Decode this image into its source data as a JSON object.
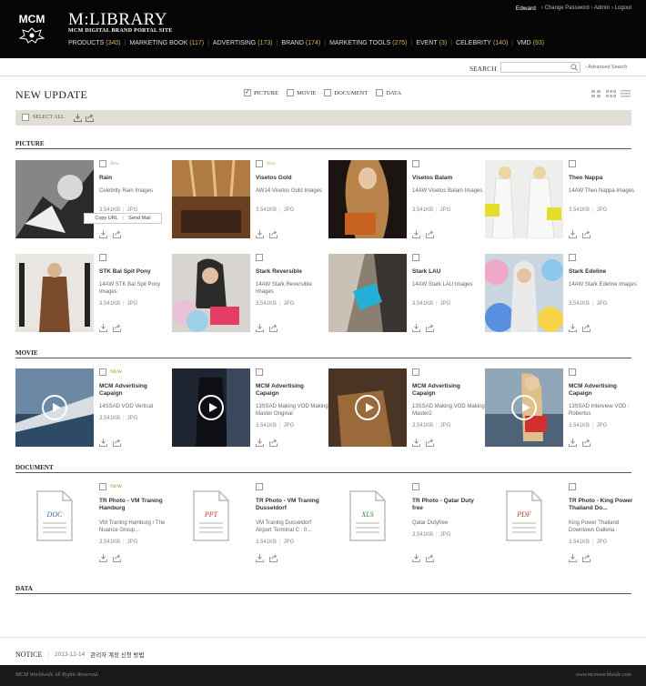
{
  "header": {
    "logo_text": "MCM",
    "title": "M:LIBRARY",
    "subtitle": "MCM DIGITAL BRAND PORTAL SITE",
    "user": "Edward",
    "links": [
      "Change Password",
      "Admin",
      "Logout"
    ],
    "nav": [
      {
        "label": "PRODUCTS",
        "count": "(340)"
      },
      {
        "label": "MARKETING BOOK",
        "count": "(117)"
      },
      {
        "label": "ADVERTISING",
        "count": "(173)"
      },
      {
        "label": "BRAND",
        "count": "(174)"
      },
      {
        "label": "MARKETING TOOLS",
        "count": "(275)"
      },
      {
        "label": "EVENT",
        "count": "(3)"
      },
      {
        "label": "CELEBRITY",
        "count": "(140)"
      },
      {
        "label": "VMD",
        "count": "(93)"
      }
    ]
  },
  "search": {
    "label": "SEARCH",
    "value": "",
    "placeholder": "",
    "advanced": "› Advanced Search"
  },
  "page": {
    "title": "NEW UPDATE"
  },
  "filters": [
    {
      "label": "PICTURE",
      "checked": true
    },
    {
      "label": "MOVIE",
      "checked": false
    },
    {
      "label": "DOCUMENT",
      "checked": false
    },
    {
      "label": "DATA",
      "checked": false
    }
  ],
  "select_all": "SELECT ALL",
  "sections": {
    "picture": "PICTURE",
    "movie": "MOVIE",
    "document": "DOCUMENT",
    "data": "DATA"
  },
  "popup": {
    "copy_url": "Copy URL",
    "send_mail": "Send Mail"
  },
  "pictures": [
    {
      "new": "New",
      "title": "Rain",
      "desc": "Celebrity Rain Images",
      "size": "3,541KB",
      "type": "JPG"
    },
    {
      "new": "New",
      "title": "Visetos Gold",
      "desc": "AW14 Visetos Gold Images",
      "size": "3,541KB",
      "type": "JPG"
    },
    {
      "new": "",
      "title": "Visetos Balam",
      "desc": "14AW Visetos Balam Images",
      "size": "3,541KB",
      "type": "JPG"
    },
    {
      "new": "",
      "title": "Theo Nappa",
      "desc": "14AW Theo Nappa Images",
      "size": "3,541KB",
      "type": "JPG"
    },
    {
      "new": "",
      "title": "STK Bal Spit Pony",
      "desc": "14AW STK Bal Spit Pony Images",
      "size": "3,541KB",
      "type": "JPG"
    },
    {
      "new": "",
      "title": "Stark Reversible",
      "desc": "14AW Stark Reversible Images",
      "size": "3,541KB",
      "type": "JPG"
    },
    {
      "new": "",
      "title": "Stark LAU",
      "desc": "14AW Stark LAU Images",
      "size": "3,541KB",
      "type": "JPG"
    },
    {
      "new": "",
      "title": "Stark Edeline",
      "desc": "14AW Stark Edeline Images",
      "size": "3,541KB",
      "type": "JPG"
    }
  ],
  "movies": [
    {
      "new": "NEW",
      "title": "MCM Advertising Capaign",
      "desc": "14SSAD VOD Vertical",
      "size": "3,541KB",
      "type": "JPG"
    },
    {
      "new": "",
      "title": "MCM Advertising Capaign",
      "desc": "13SSAD Making VOD Making Master Original",
      "size": "3,541KB",
      "type": "JPG"
    },
    {
      "new": "",
      "title": "MCM Advertising Capaign",
      "desc": "13SSAD Making VOD Making Master2",
      "size": "3,541KB",
      "type": "JPG"
    },
    {
      "new": "",
      "title": "MCM Advertising Capaign",
      "desc": "13SSAD Interview VOD : Robertus",
      "size": "3,541KB",
      "type": "JPG"
    }
  ],
  "documents": [
    {
      "new": "NEW",
      "doctype": "DOC",
      "color": "#3a63b0",
      "title": "TR Photo - VM Traning Hamburg",
      "desc": "VM Traning Hamburg / The Nuance Group...",
      "size": "3,541KB",
      "type": "JPG"
    },
    {
      "new": "",
      "doctype": "PPT",
      "color": "#c0392b",
      "title": "TR Photo - VM Traning Dusseldorf",
      "desc": "VM Traning Dusseldorf Airport Terminal C : 0...",
      "size": "3,541KB",
      "type": "JPG"
    },
    {
      "new": "",
      "doctype": "XLS",
      "color": "#2e8b3c",
      "title": "TR Photo - Qatar Duty free",
      "desc": "Qatar Dutyfree",
      "size": "3,541KB",
      "type": "JPG"
    },
    {
      "new": "",
      "doctype": "PDF",
      "color": "#c0392b",
      "title": "TR Photo - King Power Thailand Do...",
      "desc": "King Power Thailand Downtown Galleria :",
      "size": "3,541KB",
      "type": "JPG"
    }
  ],
  "notice": {
    "label": "NOTICE",
    "date": "2013-12-14",
    "text": "관리자 계정 신청 방법"
  },
  "footer": {
    "copyright": "MCM Worldwide All Rights Reserved.",
    "url": "www.mcmworldwide.com"
  }
}
